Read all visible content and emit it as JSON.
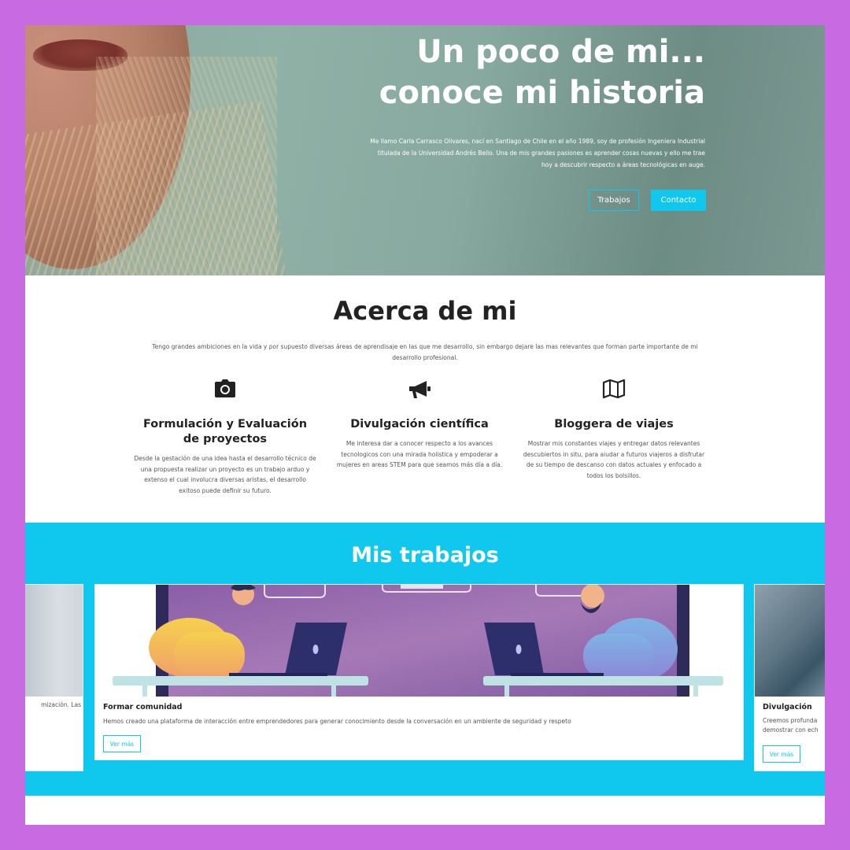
{
  "hero": {
    "title_line1": "Un poco de mi...",
    "title_line2": "conoce mi historia",
    "text": "Me llamo Carla Carrasco Olivares, nací en Santiago de Chile en el año 1989, soy de profesión Ingeniera Industrial titulada de la Universidad Andrés Bello. Una de mis grandes pasiones es aprender cosas nuevas y ello me trae hoy a descubrir respecto a áreas tecnológicas en auge.",
    "buttons": {
      "trabajos": "Trabajos",
      "contacto": "Contacto"
    }
  },
  "about": {
    "title": "Acerca de mi",
    "subtitle": "Tengo grandes ambiciones en la vida y por supuesto diversas áreas de aprendisaje en las que me desarrollo, sin embargo dejare las mas relevantes que forman parte importante de mi desarrollo profesional.",
    "features": [
      {
        "icon": "camera-icon",
        "title": "Formulación y Evaluación de proyectos",
        "text": "Desde la gestación de una idea hasta el desarrollo técnico de una propuesta realizar un proyecto es un trabajo arduo y extenso el cual involucra diversas aristas, el desarrollo exitoso puede definir su futuro."
      },
      {
        "icon": "megaphone-icon",
        "title": "Divulgación científica",
        "text": "Me interesa dar a conocer respecto a los avances tecnologicos con una mirada holistica y empoderar a mujeres en areas STEM para que seamos más día a día."
      },
      {
        "icon": "map-icon",
        "title": "Bloggera de viajes",
        "text": "Mostrar mis constantes viajes y entregar datos relevantes descubiertos in situ, para aiudar a futuros viajeros a disfrutar de su tiempo de descanso con datos actuales y enfocado a todos los bolsillos."
      }
    ]
  },
  "works": {
    "title": "Mis trabajos",
    "cards": [
      {
        "title": "",
        "text": "mización. Las",
        "button": ""
      },
      {
        "title": "Formar comunidad",
        "text": "Hemos creado una plataforma de interacción entre emprendedores para generar conocimiento desde la conversación en un ambiente de seguridad y respeto",
        "button": "Ver más"
      },
      {
        "title": "Divulgación",
        "text_line1": "Creemos profunda",
        "text_line2": "demostrar con ech",
        "button": "Ver más"
      }
    ]
  },
  "next_section": {
    "title": ""
  },
  "colors": {
    "accent": "#10c8ee",
    "frame": "#c86be3",
    "heading": "#222222"
  }
}
